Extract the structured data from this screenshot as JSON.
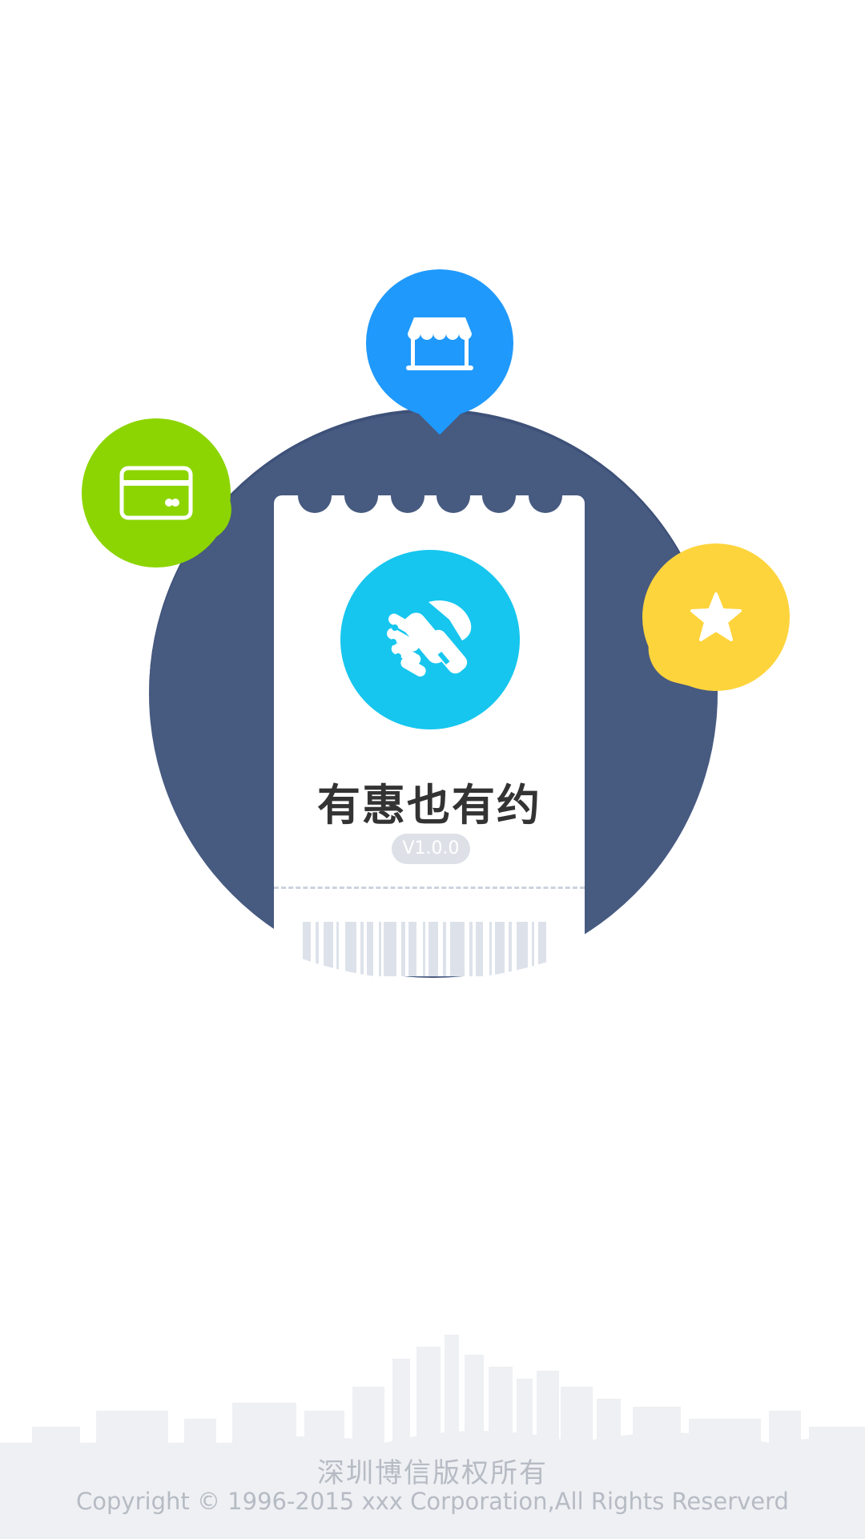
{
  "app": {
    "name": "有惠也有约",
    "version": "V1.0.0"
  },
  "icons": {
    "shop": "shop-icon",
    "card": "card-icon",
    "star": "star-icon",
    "handshake": "handshake-icon"
  },
  "colors": {
    "circle": "#475a80",
    "shop_bubble": "#1f99fb",
    "card_bubble": "#8cd502",
    "star_bubble": "#fed43c",
    "logo": "#16c6ee"
  },
  "footer": {
    "company": "深圳博信版权所有",
    "copyright": "Copyright © 1996-2015 xxx Corporation,All Rights Reserverd"
  }
}
